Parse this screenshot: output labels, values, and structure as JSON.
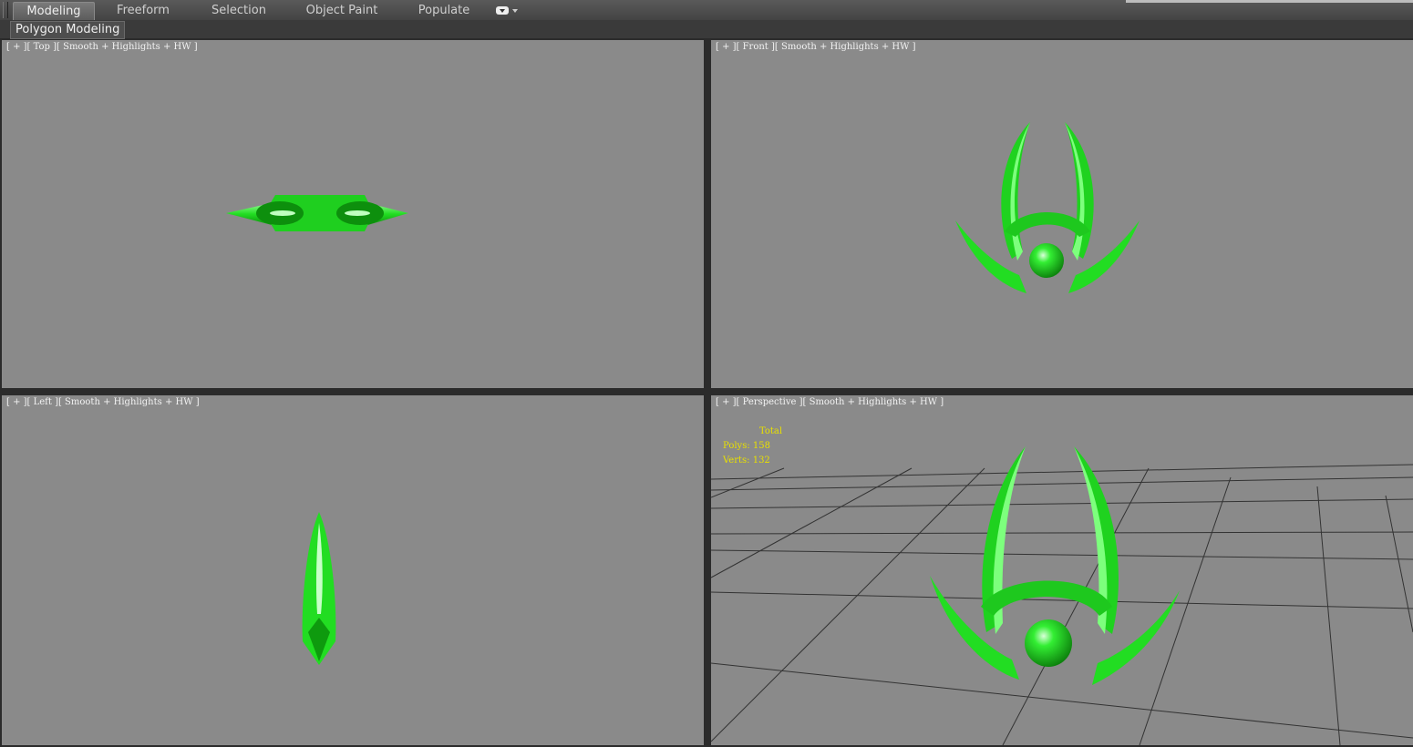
{
  "tabs": [
    {
      "label": "Modeling",
      "active": true
    },
    {
      "label": "Freeform"
    },
    {
      "label": "Selection"
    },
    {
      "label": "Object Paint"
    },
    {
      "label": "Populate"
    }
  ],
  "panel": {
    "label": "Polygon Modeling"
  },
  "viewports": {
    "top": {
      "label": "[ + ][ Top ][ Smooth + Highlights + HW ]"
    },
    "front": {
      "label": "[ + ][ Front ][ Smooth + Highlights + HW ]"
    },
    "left": {
      "label": "[ + ][ Left ][ Smooth + Highlights + HW ]"
    },
    "perspective": {
      "label": "[ + ][ Perspective ][ Smooth + Highlights + HW ]"
    }
  },
  "stats": {
    "total": "Total",
    "polys": "Polys: 158",
    "verts": "Verts: 132"
  },
  "colors": {
    "viewport_bg": "#8a8a8a",
    "model_green": "#22dd22",
    "stats_text": "#e8e000"
  }
}
